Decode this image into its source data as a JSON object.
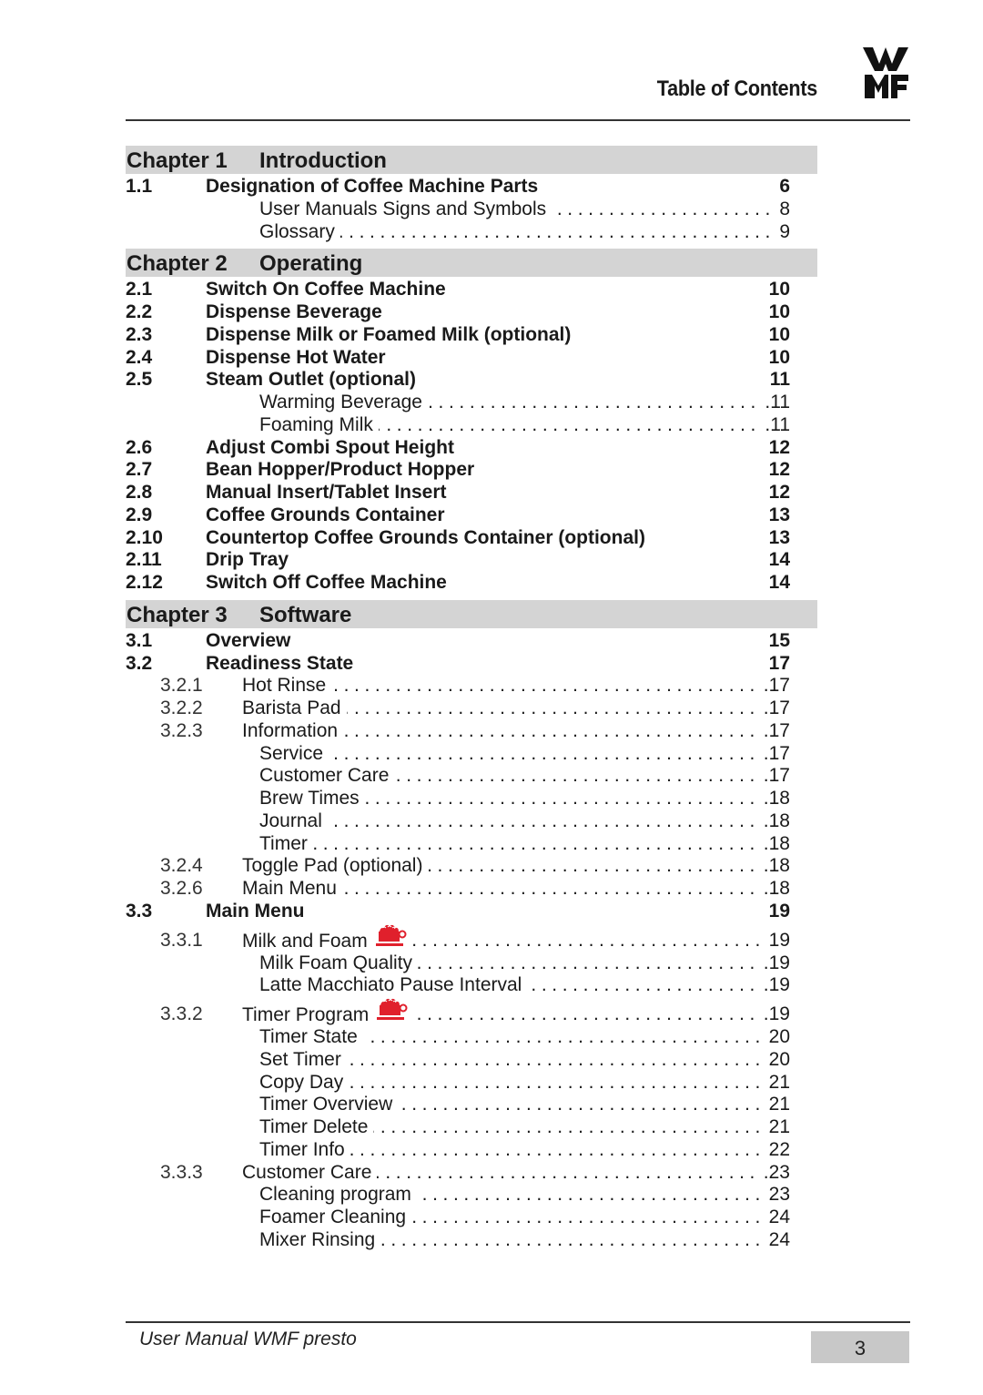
{
  "header": {
    "title": "Table of Contents",
    "logo": "WMF"
  },
  "chapters": [
    {
      "number": "Chapter 1",
      "title": "Introduction"
    },
    {
      "number": "Chapter 2",
      "title": "Operating"
    },
    {
      "number": "Chapter 3",
      "title": "Software"
    }
  ],
  "ch1": [
    {
      "type": "sec",
      "num": "1.1",
      "title": "Designation of Coffee Machine Parts",
      "page": "6"
    },
    {
      "type": "item",
      "title": "User Manuals Signs and Symbols",
      "page": "8"
    },
    {
      "type": "item",
      "title": "Glossary",
      "page": "9"
    }
  ],
  "ch2": [
    {
      "type": "sec",
      "num": "2.1",
      "title": "Switch On Coffee Machine",
      "page": "10"
    },
    {
      "type": "sec",
      "num": "2.2",
      "title": "Dispense Beverage",
      "page": "10"
    },
    {
      "type": "sec",
      "num": "2.3",
      "title": "Dispense Milk or Foamed Milk (optional)",
      "page": "10"
    },
    {
      "type": "sec",
      "num": "2.4",
      "title": "Dispense Hot Water",
      "page": "10"
    },
    {
      "type": "sec",
      "num": "2.5",
      "title": "Steam Outlet (optional)",
      "page": "11"
    },
    {
      "type": "item",
      "title": "Warming Beverage",
      "page": ".11"
    },
    {
      "type": "item",
      "title": "Foaming Milk",
      "page": ".11"
    },
    {
      "type": "sec",
      "num": "2.6",
      "title": "Adjust Combi Spout Height",
      "page": "12"
    },
    {
      "type": "sec",
      "num": "2.7",
      "title": "Bean Hopper/Product Hopper",
      "page": "12"
    },
    {
      "type": "sec",
      "num": "2.8",
      "title": "Manual Insert/Tablet Insert",
      "page": "12"
    },
    {
      "type": "sec",
      "num": "2.9",
      "title": "Coffee Grounds Container",
      "page": "13"
    },
    {
      "type": "sec",
      "num": "2.10",
      "title": "Countertop Coffee Grounds Container (optional)",
      "page": "13"
    },
    {
      "type": "sec",
      "num": "2.11",
      "title": "Drip Tray",
      "page": "14"
    },
    {
      "type": "sec",
      "num": "2.12",
      "title": "Switch Off Coffee Machine",
      "page": "14"
    }
  ],
  "ch3": [
    {
      "type": "sec",
      "num": "3.1",
      "title": "Overview",
      "page": "15"
    },
    {
      "type": "sec",
      "num": "3.2",
      "title": "Readiness State",
      "page": "17"
    },
    {
      "type": "sub",
      "num": "3.2.1",
      "title": "Hot Rinse",
      "page": ".17"
    },
    {
      "type": "sub",
      "num": "3.2.2",
      "title": "Barista Pad",
      "page": ".17"
    },
    {
      "type": "sub",
      "num": "3.2.3",
      "title": "Information",
      "page": ".17"
    },
    {
      "type": "item",
      "title": "Service",
      "page": ".17"
    },
    {
      "type": "item",
      "title": "Customer Care",
      "page": ".17"
    },
    {
      "type": "item",
      "title": "Brew Times",
      "page": ".18"
    },
    {
      "type": "item",
      "title": "Journal",
      "page": ".18"
    },
    {
      "type": "item",
      "title": "Timer",
      "page": ".18"
    },
    {
      "type": "sub",
      "num": "3.2.4",
      "title": "Toggle Pad (optional)",
      "page": ".18"
    },
    {
      "type": "sub",
      "num": "3.2.6",
      "title": "Main Menu",
      "page": ".18"
    },
    {
      "type": "sec",
      "num": "3.3",
      "title": "Main Menu",
      "page": "19"
    },
    {
      "type": "sub",
      "num": "3.3.1",
      "title": "Milk and Foam",
      "page": "19",
      "icon": "milk-foam-cup-icon"
    },
    {
      "type": "item",
      "title": "Milk Foam Quality",
      "page": ".19"
    },
    {
      "type": "item",
      "title": "Latte Macchiato Pause Interval",
      "page": ".19"
    },
    {
      "type": "sub",
      "num": "3.3.2",
      "title": "Timer Program",
      "page": ".19",
      "icon": "milk-foam-cup-icon"
    },
    {
      "type": "item",
      "title": "Timer State",
      "page": "20"
    },
    {
      "type": "item",
      "title": "Set Timer",
      "page": "20"
    },
    {
      "type": "item",
      "title": "Copy Day",
      "page": "21"
    },
    {
      "type": "item",
      "title": "Timer Overview",
      "page": "21"
    },
    {
      "type": "item",
      "title": "Timer Delete",
      "page": "21"
    },
    {
      "type": "item",
      "title": "Timer Info",
      "page": "22"
    },
    {
      "type": "sub",
      "num": "3.3.3",
      "title": "Customer Care",
      "page": ".23"
    },
    {
      "type": "item",
      "title": "Cleaning program",
      "page": "23"
    },
    {
      "type": "item",
      "title": "Foamer Cleaning",
      "page": "24"
    },
    {
      "type": "item",
      "title": "Mixer Rinsing",
      "page": "24"
    }
  ],
  "colors": {
    "icon_red": "#e0202c",
    "chapter_band": "#d4d4d4",
    "page_box": "#c8c8c8"
  },
  "footer": {
    "text": "User Manual WMF presto",
    "page_number": "3"
  }
}
